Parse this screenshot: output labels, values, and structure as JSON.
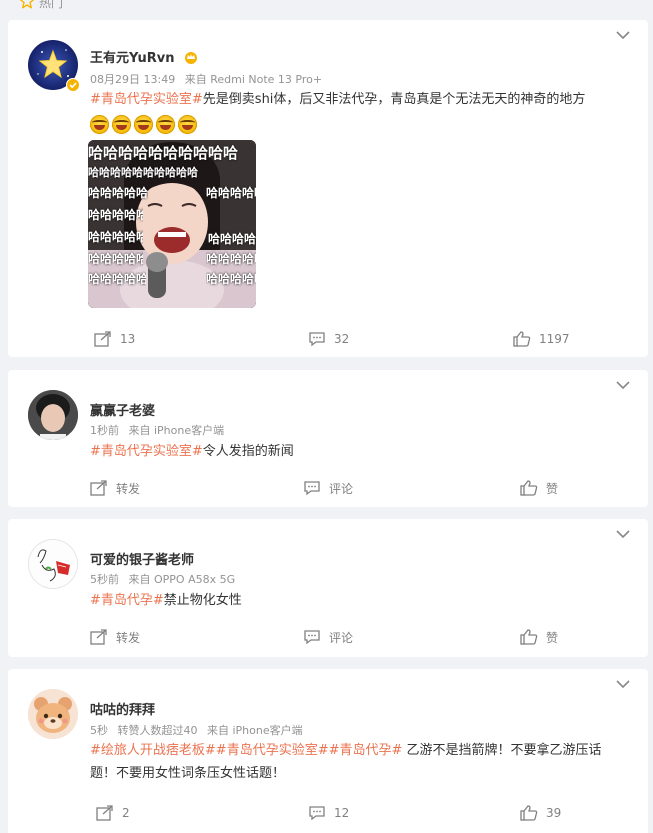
{
  "header": {
    "hot_label": "热门"
  },
  "posts": [
    {
      "username": "王有元YuRvn",
      "time": "08月29日 13:49",
      "source": "来自 Redmi Note 13 Pro+",
      "topic": "#青岛代孕实验室#",
      "body": "先是倒卖shi体，后又非法代孕，青岛真是个无法无天的神奇的地方",
      "image_overlay_text": "哈哈哈哈哈哈哈哈哈哈",
      "repost": "13",
      "comment": "32",
      "like": "1197"
    },
    {
      "username": "赢赢子老婆",
      "time": "1秒前",
      "source": "来自 iPhone客户端",
      "topic": "#青岛代孕实验室#",
      "body": "令人发指的新闻",
      "repost": "转发",
      "comment": "评论",
      "like": "赞"
    },
    {
      "username": "可爱的银子酱老师",
      "time": "5秒前",
      "source": "来自 OPPO A58x 5G",
      "topic": "#青岛代孕#",
      "body": "禁止物化女性",
      "repost": "转发",
      "comment": "评论",
      "like": "赞"
    },
    {
      "username": "咕咕的拜拜",
      "time": "5秒",
      "extra": "转赞人数超过40",
      "source": "来自 iPhone客户端",
      "topics": [
        "#绘旅人开战痞老板#",
        "#青岛代孕实验室#",
        "#青岛代孕#"
      ],
      "body_line1": " 乙游不是挡箭牌！不要拿乙游压话",
      "body_line2": "题！不要用女性词条压女性话题！",
      "repost": "2",
      "comment": "12",
      "like": "39"
    }
  ],
  "colors": {
    "topic": "#eb7350",
    "meta": "#939393",
    "background": "#f1f2f5",
    "vip_badge": "#f6b400"
  }
}
